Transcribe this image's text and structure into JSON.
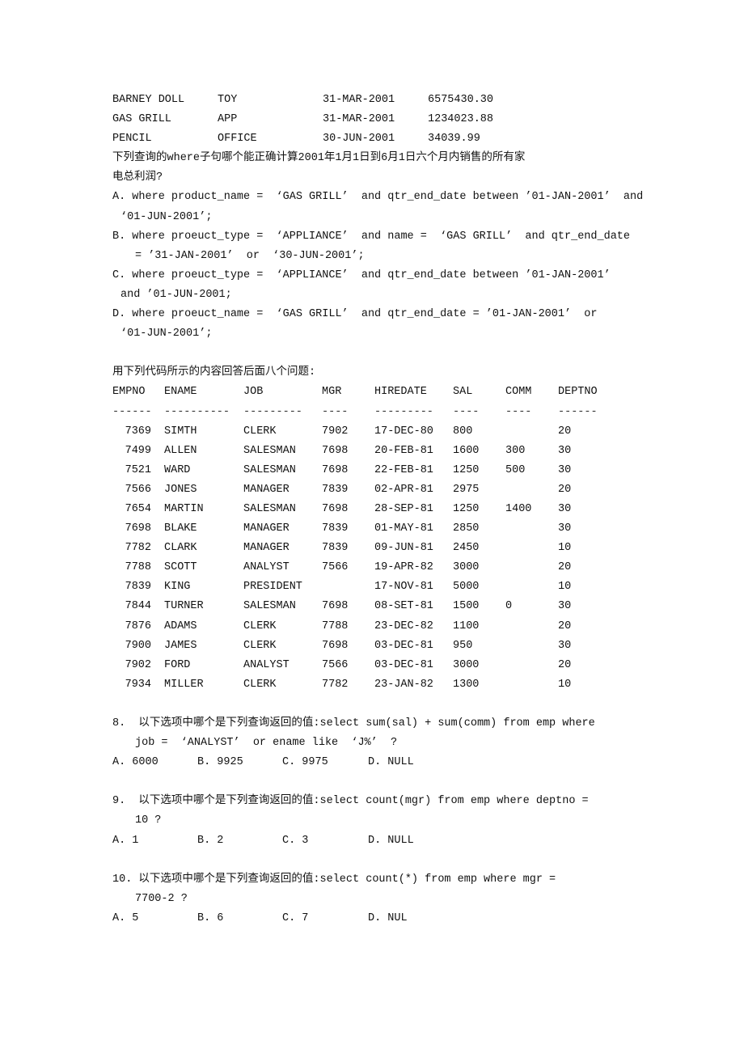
{
  "products": [
    [
      "BARNEY DOLL",
      "TOY",
      "31-MAR-2001",
      "6575430.30"
    ],
    [
      "GAS GRILL",
      "APP",
      "31-MAR-2001",
      "1234023.88"
    ],
    [
      "PENCIL",
      "OFFICE",
      "30-JUN-2001",
      "34039.99"
    ]
  ],
  "q_where": {
    "lines": [
      "下列查询的where子句哪个能正确计算2001年1月1日到6月1日六个月内销售的所有家",
      "电总利润?"
    ],
    "options": [
      [
        "A. where product_name =  ‘GAS GRILL’  and qtr_end_date between ’01-JAN-2001’  and",
        "‘01-JUN-2001’;"
      ],
      [
        "B. where proeuct_type =  ‘APPLIANCE’  and name =  ‘GAS GRILL’  and qtr_end_date",
        "= ’31-JAN-2001’  or  ‘30-JUN-2001’;"
      ],
      [
        "C. where proeuct_type =  ‘APPLIANCE’  and qtr_end_date between ’01-JAN-2001’",
        "and ’01-JUN-2001;"
      ],
      [
        "D. where proeuct_name =  ‘GAS GRILL’  and qtr_end_date = ’01-JAN-2001’  or",
        "‘01-JUN-2001’;"
      ]
    ]
  },
  "intro": "用下列代码所示的内容回答后面八个问题:",
  "emp": {
    "headers": [
      "EMPNO",
      "ENAME",
      "JOB",
      "MGR",
      "HIREDATE",
      "SAL",
      "COMM",
      "DEPTNO"
    ],
    "dashes": [
      "------",
      "----------",
      "---------",
      "----",
      "---------",
      "----",
      "----",
      "------"
    ],
    "rows": [
      [
        "7369",
        "SIMTH",
        "CLERK",
        "7902",
        "17-DEC-80",
        "800",
        "",
        "20"
      ],
      [
        "7499",
        "ALLEN",
        "SALESMAN",
        "7698",
        "20-FEB-81",
        "1600",
        "300",
        "30"
      ],
      [
        "7521",
        "WARD",
        "SALESMAN",
        "7698",
        "22-FEB-81",
        "1250",
        "500",
        "30"
      ],
      [
        "7566",
        "JONES",
        "MANAGER",
        "7839",
        "02-APR-81",
        "2975",
        "",
        "20"
      ],
      [
        "7654",
        "MARTIN",
        "SALESMAN",
        "7698",
        "28-SEP-81",
        "1250",
        "1400",
        "30"
      ],
      [
        "7698",
        "BLAKE",
        "MANAGER",
        "7839",
        "01-MAY-81",
        "2850",
        "",
        "30"
      ],
      [
        "7782",
        "CLARK",
        "MANAGER",
        "7839",
        "09-JUN-81",
        "2450",
        "",
        "10"
      ],
      [
        "7788",
        "SCOTT",
        "ANALYST",
        "7566",
        "19-APR-82",
        "3000",
        "",
        "20"
      ],
      [
        "7839",
        "KING",
        "PRESIDENT",
        "",
        "17-NOV-81",
        "5000",
        "",
        "10"
      ],
      [
        "7844",
        "TURNER",
        "SALESMAN",
        "7698",
        "08-SET-81",
        "1500",
        "0",
        "30"
      ],
      [
        "7876",
        "ADAMS",
        "CLERK",
        "7788",
        "23-DEC-82",
        "1100",
        "",
        "20"
      ],
      [
        "7900",
        "JAMES",
        "CLERK",
        "7698",
        "03-DEC-81",
        "950",
        "",
        "30"
      ],
      [
        "7902",
        "FORD",
        "ANALYST",
        "7566",
        "03-DEC-81",
        "3000",
        "",
        "20"
      ],
      [
        "7934",
        "MILLER",
        "CLERK",
        "7782",
        "23-JAN-82",
        "1300",
        "",
        "10"
      ]
    ]
  },
  "questions": [
    {
      "lines": [
        "8.  以下选项中哪个是下列查询返回的值:select sum(sal) + sum(comm) from emp where",
        "job =  ‘ANALYST’  or ename like  ‘J%’  ?"
      ],
      "options": [
        "A. 6000",
        "B. 9925",
        "C. 9975",
        "D. NULL"
      ]
    },
    {
      "lines": [
        "9.  以下选项中哪个是下列查询返回的值:select count(mgr) from emp where deptno =",
        "10 ?"
      ],
      "options": [
        "A. 1",
        "B. 2",
        "C. 3",
        "D. NULL"
      ]
    },
    {
      "lines": [
        "10. 以下选项中哪个是下列查询返回的值:select count(*) from emp where mgr =",
        "7700-2 ?"
      ],
      "options": [
        "A. 5",
        "B. 6",
        "C. 7",
        "D. NUL"
      ]
    }
  ]
}
